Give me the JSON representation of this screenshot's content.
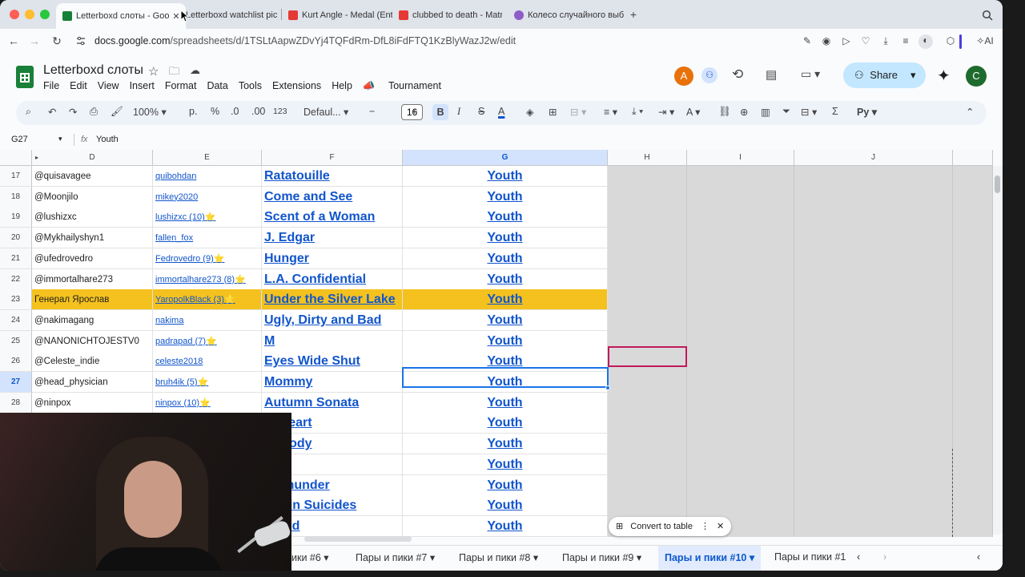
{
  "browser": {
    "tabs": [
      {
        "label": "Letterboxd слоты - Goog",
        "color": "#188038",
        "active": true
      },
      {
        "label": "Letterboxd watchlist pic",
        "color": "#bdc1c6"
      },
      {
        "label": "Kurt Angle - Medal (Entr",
        "color": "#e53935"
      },
      {
        "label": "clubbed to death - Matri",
        "color": "#e53935"
      },
      {
        "label": "Колесо случайного выб",
        "color": "#8e5cc6"
      }
    ],
    "url_host": "docs.google.com",
    "url_path": "/spreadsheets/d/1TSLtAapwZDvYj4TQFdRm-DfL8iFdFTQ1KzBlyWazJ2w/edit",
    "ai_label": "AI"
  },
  "sheet": {
    "title": "Letterboxd слоты",
    "menu": [
      "File",
      "Edit",
      "View",
      "Insert",
      "Format",
      "Data",
      "Tools",
      "Extensions",
      "Help",
      "Tournament"
    ],
    "share_label": "Share",
    "avatar_a": "A",
    "avatar_c": "C",
    "zoom": "100%",
    "currency": "р.",
    "percent": "%",
    "dec_less": ".0",
    "dec_more": ".00",
    "number_fmt": "123",
    "font": "Defaul...",
    "font_size": "16",
    "cell_ref": "G27",
    "formula": "Youth",
    "columns": [
      "D",
      "E",
      "F",
      "G",
      "H",
      "I",
      "J"
    ],
    "rows": [
      {
        "n": "17",
        "d": "@quisavagee",
        "e": "quibohdan",
        "f": "Ratatouille",
        "g": "Youth"
      },
      {
        "n": "18",
        "d": "@Moonjilo",
        "e": "mikey2020",
        "f": "Come and See",
        "g": "Youth"
      },
      {
        "n": "19",
        "d": "@lushizxc",
        "e": "lushizxc (10)⭐",
        "f": "Scent of a Woman",
        "g": "Youth"
      },
      {
        "n": "20",
        "d": "@Mykhailyshyn1",
        "e": "fallen_fox",
        "f": "J. Edgar",
        "g": "Youth"
      },
      {
        "n": "21",
        "d": "@ufedrovedro",
        "e": "Fedrovedro (9)⭐",
        "f": "Hunger",
        "g": "Youth"
      },
      {
        "n": "22",
        "d": "@immortalhare273",
        "e": "immortalhare273 (8)⭐",
        "f": "L.A. Confidential",
        "g": "Youth"
      },
      {
        "n": "23",
        "d": "Генерал Ярослав",
        "e": "YaropolkBlack (3)⭐",
        "f": "Under the Silver Lake",
        "g": "Youth",
        "hl": true
      },
      {
        "n": "24",
        "d": "@nakimagang",
        "e": "nakima",
        "f": "Ugly, Dirty and Bad",
        "g": "Youth"
      },
      {
        "n": "25",
        "d": "@NANONICHTOJESTV0",
        "e": "padrapad (7)⭐",
        "f": "M",
        "g": "Youth"
      },
      {
        "n": "26",
        "d": "@Celeste_indie",
        "e": "celeste2018",
        "f": "Eyes Wide Shut",
        "g": "Youth"
      },
      {
        "n": "27",
        "d": "@head_physician",
        "e": "bruh4ik (5)⭐",
        "f": "Mommy",
        "g": "Youth",
        "sel": true
      },
      {
        "n": "28",
        "d": "@ninpox",
        "e": "ninpox (10)⭐",
        "f": "Autumn Sonata",
        "g": "Youth"
      },
      {
        "n": "",
        "d": "",
        "e": "",
        "f": "at Heart",
        "g": "Youth"
      },
      {
        "n": "",
        "d": "",
        "e": "",
        "f": "Nobody",
        "g": "Youth"
      },
      {
        "n": "",
        "d": "",
        "e": "",
        "f": "ody",
        "g": "Youth"
      },
      {
        "n": "",
        "d": "",
        "e": "",
        "f": "ic Thunder",
        "g": "Youth"
      },
      {
        "n": "",
        "d": "",
        "e": "",
        "f": "Virgin Suicides",
        "g": "Youth"
      },
      {
        "n": "",
        "d": "",
        "e": "",
        "f": "o Red",
        "g": "Youth"
      }
    ],
    "convert_label": "Convert to table",
    "sheet_tabs": [
      "ики #6",
      "Пары и пики #7",
      "Пары и пики #8",
      "Пары и пики #9",
      "Пары и пики #10",
      "Пары и пики #1"
    ],
    "active_sheet_index": 4
  }
}
